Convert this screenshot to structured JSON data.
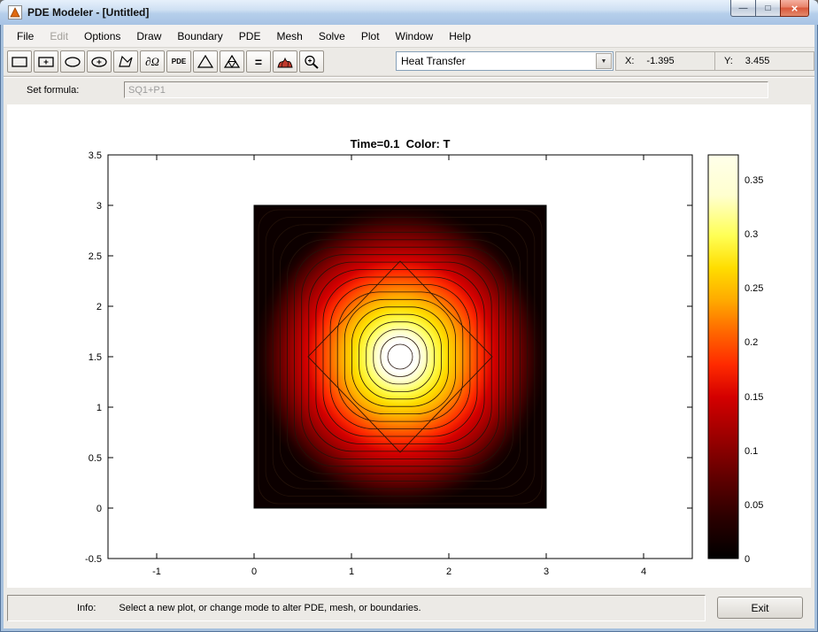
{
  "window": {
    "title": "PDE Modeler - [Untitled]",
    "controls": {
      "minimize": "—",
      "maximize": "□",
      "close": "×"
    }
  },
  "menu": {
    "items": [
      {
        "label": "File"
      },
      {
        "label": "Edit",
        "disabled": true
      },
      {
        "label": "Options"
      },
      {
        "label": "Draw"
      },
      {
        "label": "Boundary"
      },
      {
        "label": "PDE"
      },
      {
        "label": "Mesh"
      },
      {
        "label": "Solve"
      },
      {
        "label": "Plot"
      },
      {
        "label": "Window"
      },
      {
        "label": "Help"
      }
    ]
  },
  "toolbar": {
    "boundary_label": "∂Ω",
    "pde_label": "PDE",
    "solve_label": "=",
    "dropdown_arrow": "▼",
    "application": "Heat Transfer",
    "coords": {
      "x_label": "X:",
      "x_value": "-1.395",
      "y_label": "Y:",
      "y_value": "3.455"
    }
  },
  "formula": {
    "label": "Set formula:",
    "value": "SQ1+P1"
  },
  "plot": {
    "title": "Time=0.1  Color: T",
    "colormap": "hot",
    "x_tick_labels": [
      "-1",
      "0",
      "1",
      "2",
      "3",
      "4"
    ],
    "y_tick_labels": [
      "3.5",
      "3",
      "2.5",
      "2",
      "1.5",
      "1",
      "0.5",
      "0",
      "-0.5"
    ],
    "colorbar_tick_labels": [
      "0.35",
      "0.3",
      "0.25",
      "0.2",
      "0.15",
      "0.1",
      "0.05",
      "0"
    ],
    "domain_square": [
      0,
      0,
      3,
      3
    ],
    "hotspot_center": [
      1.5,
      1.5
    ]
  },
  "status": {
    "info_label": "Info:",
    "message": "Select a new plot, or change mode to alter PDE, mesh, or boundaries.",
    "exit_label": "Exit"
  }
}
